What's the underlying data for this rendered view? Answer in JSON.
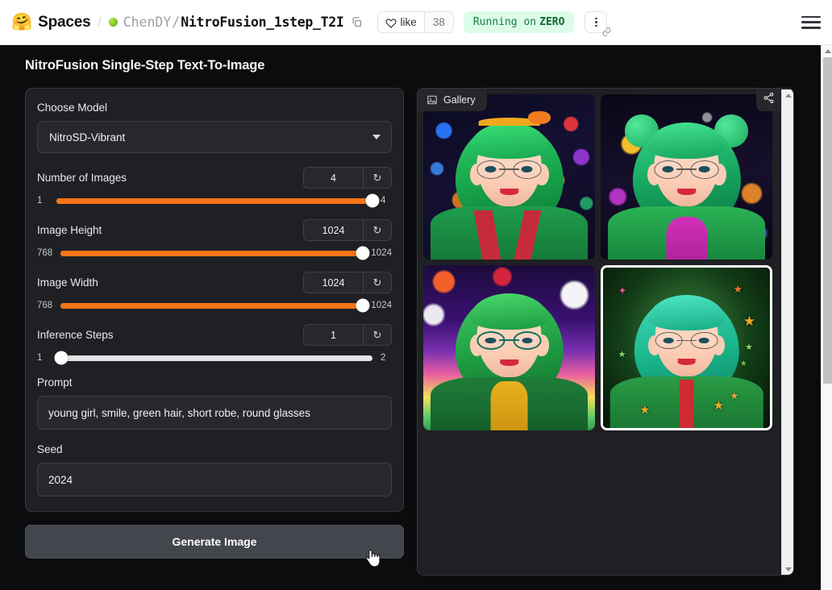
{
  "header": {
    "logo_icon": "hugging-face-emoji",
    "spaces_label": "Spaces",
    "divider": "/",
    "owner": "ChenDY",
    "slash": "/",
    "repo_name": "NitroFusion_1step_T2I",
    "copy_icon": "copy-icon",
    "like_label": "like",
    "like_count": "38",
    "status_prefix": "Running on",
    "status_accent": "ZERO",
    "more_icon": "three-dots-vertical-icon",
    "link_icon": "link-icon",
    "menu_icon": "hamburger-menu-icon"
  },
  "app": {
    "title": "NitroFusion Single-Step Text-To-Image"
  },
  "controls": {
    "model": {
      "label": "Choose Model",
      "value": "NitroSD-Vibrant",
      "chevron_icon": "chevron-down-icon"
    },
    "sliders": [
      {
        "label": "Number of Images",
        "value": "4",
        "min": "1",
        "max": "4",
        "percent": 100,
        "reset_icon": "reset-icon",
        "name": "number-of-images"
      },
      {
        "label": "Image Height",
        "value": "1024",
        "min": "768",
        "max": "1024",
        "percent": 100,
        "reset_icon": "reset-icon",
        "name": "image-height"
      },
      {
        "label": "Image Width",
        "value": "1024",
        "min": "768",
        "max": "1024",
        "percent": 100,
        "reset_icon": "reset-icon",
        "name": "image-width"
      },
      {
        "label": "Inference Steps",
        "value": "1",
        "min": "1",
        "max": "2",
        "percent": 0,
        "reset_icon": "reset-icon",
        "name": "inference-steps"
      }
    ],
    "prompt": {
      "label": "Prompt",
      "value": "young girl, smile, green hair, short robe, round glasses"
    },
    "seed": {
      "label": "Seed",
      "value": "2024"
    },
    "generate_button": "Generate Image"
  },
  "gallery": {
    "tab_label": "Gallery",
    "tab_icon": "image-icon",
    "share_icon": "share-icon",
    "items": [
      {
        "alt": "green-haired girl with glasses on neon city background",
        "selected": false
      },
      {
        "alt": "green-haired girl with hair buns and magenta robe on bokeh lights",
        "selected": false
      },
      {
        "alt": "green-haired girl with glasses on rainbow cosmic background",
        "selected": false
      },
      {
        "alt": "green-haired girl in green robe with stars on dark green background",
        "selected": true
      }
    ]
  },
  "colors": {
    "accent_orange": "#f97316",
    "panel_bg": "#1f2024",
    "app_bg": "#0b0c0e",
    "zero_badge_bg": "#dcfce9",
    "zero_badge_text": "#15803d"
  },
  "cursor": {
    "icon": "pointing-hand-cursor"
  }
}
